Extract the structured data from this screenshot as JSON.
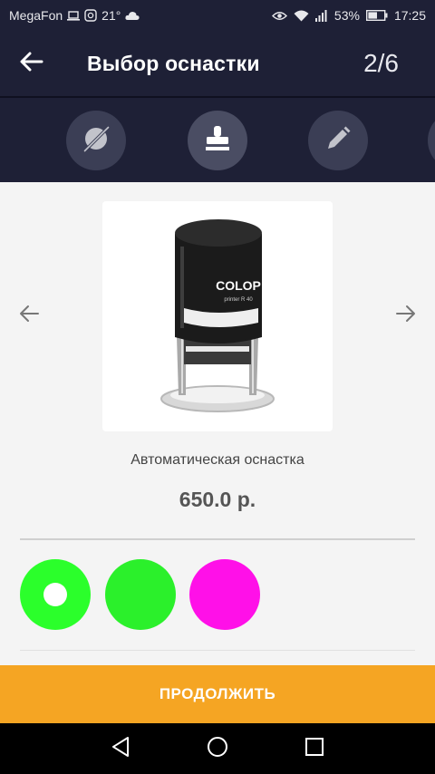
{
  "status_bar": {
    "carrier": "MegaFon",
    "temperature": "21°",
    "battery": "53%",
    "time": "17:25",
    "icons": [
      "laptop-icon",
      "messenger-icon",
      "cloud-icon",
      "eye-icon",
      "wifi-icon",
      "signal-icon",
      "battery-icon"
    ]
  },
  "header": {
    "title": "Выбор оснастки",
    "step": "2/6",
    "back_icon": "arrow-left-icon"
  },
  "toolbar": {
    "tabs": [
      {
        "icon": "no-stamp-icon",
        "active": false
      },
      {
        "icon": "stamp-icon",
        "active": true
      },
      {
        "icon": "pencil-icon",
        "active": false
      }
    ]
  },
  "product": {
    "name": "Автоматическая оснастка",
    "price": "650.0 р.",
    "image_label": "COLOP",
    "image_sublabel": "printer R 40"
  },
  "colors": [
    {
      "hex": "#2bff2b",
      "selected": true
    },
    {
      "hex": "#2bf02b",
      "selected": false
    },
    {
      "hex": "#ff10e8",
      "selected": false
    }
  ],
  "actions": {
    "continue_label": "ПРОДОЛЖИТЬ"
  },
  "theme": {
    "header_bg": "#1e2036",
    "accent": "#f5a523"
  }
}
